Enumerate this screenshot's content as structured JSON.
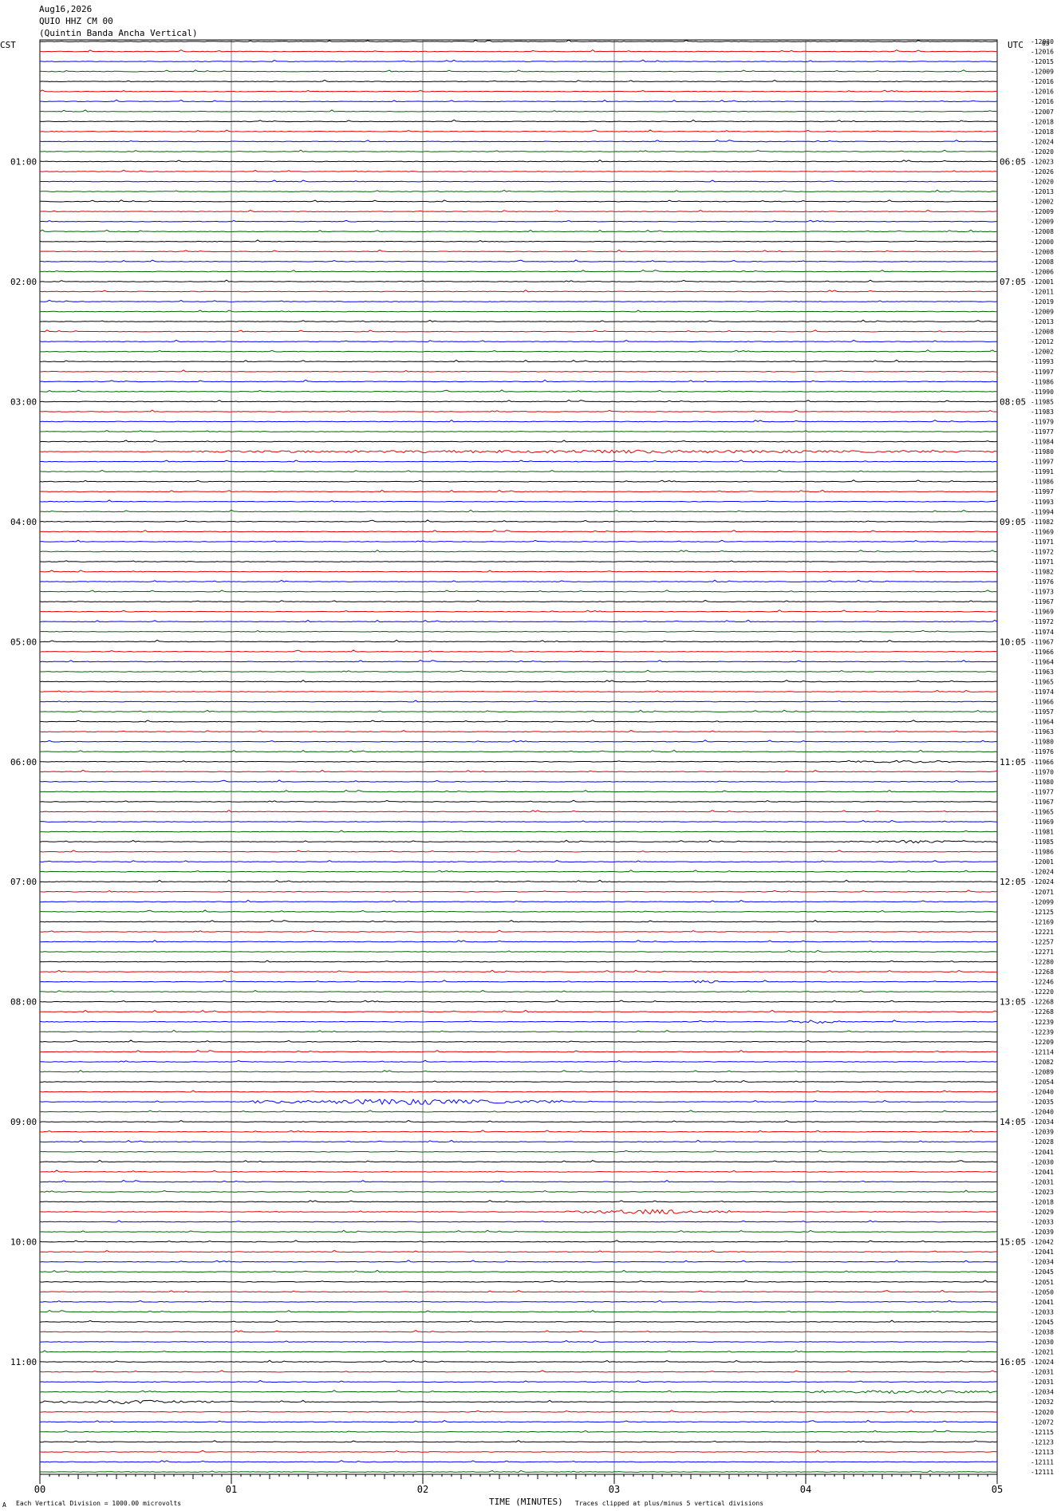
{
  "header": {
    "date": "Aug16,2026",
    "station": "QUIO HHZ CM 00",
    "description": "(Quintin Banda Ancha Vertical)",
    "left_timezone": "CST",
    "right_timezone": "UTC",
    "corner_mark": "05"
  },
  "footer": {
    "scale_note": "Each Vertical Division = 1000.00 microvolts",
    "xlabel": "TIME (MINUTES)",
    "clip_note": "Traces clipped at plus/minus 5 vertical divisions",
    "corner_mark": "A"
  },
  "colors": {
    "trace_cycle": [
      "#000000",
      "#e00000",
      "#0000ff",
      "#006400"
    ],
    "gridline": "#808080",
    "frame": "#000000"
  },
  "chart_data": {
    "type": "line",
    "title": "",
    "xlabel": "TIME (MINUTES)",
    "ylabel": "",
    "xlim": [
      0,
      5
    ],
    "x_ticks": [
      "00",
      "01",
      "02",
      "03",
      "04",
      "05"
    ],
    "trace_count": 144,
    "minutes_per_trace": 5,
    "grid": true,
    "left_hour_labels": [
      {
        "row": 12,
        "text": "01:00"
      },
      {
        "row": 24,
        "text": "02:00"
      },
      {
        "row": 36,
        "text": "03:00"
      },
      {
        "row": 48,
        "text": "04:00"
      },
      {
        "row": 60,
        "text": "05:00"
      },
      {
        "row": 72,
        "text": "06:00"
      },
      {
        "row": 84,
        "text": "07:00"
      },
      {
        "row": 96,
        "text": "08:00"
      },
      {
        "row": 108,
        "text": "09:00"
      },
      {
        "row": 120,
        "text": "10:00"
      },
      {
        "row": 132,
        "text": "11:00"
      }
    ],
    "right_hour_labels": [
      {
        "row": 12,
        "text": "06:05"
      },
      {
        "row": 24,
        "text": "07:05"
      },
      {
        "row": 36,
        "text": "08:05"
      },
      {
        "row": 48,
        "text": "09:05"
      },
      {
        "row": 60,
        "text": "10:05"
      },
      {
        "row": 72,
        "text": "11:05"
      },
      {
        "row": 84,
        "text": "12:05"
      },
      {
        "row": 96,
        "text": "13:05"
      },
      {
        "row": 108,
        "text": "14:05"
      },
      {
        "row": 120,
        "text": "15:05"
      },
      {
        "row": 132,
        "text": "16:05"
      }
    ],
    "trace_offsets": [
      "-12030",
      "-12016",
      "-12015",
      "-12009",
      "-12016",
      "-12016",
      "-12016",
      "-12007",
      "-12018",
      "-12018",
      "-12024",
      "-12020",
      "-12023",
      "-12026",
      "-12020",
      "-12013",
      "-12002",
      "-12009",
      "-12009",
      "-12008",
      "-12000",
      "-12008",
      "-12008",
      "-12006",
      "-12001",
      "-12011",
      "-12019",
      "-12009",
      "-12013",
      "-12008",
      "-12012",
      "-12002",
      "-11993",
      "-11997",
      "-11986",
      "-11990",
      "-11985",
      "-11983",
      "-11979",
      "-11977",
      "-11984",
      "-11980",
      "-11997",
      "-11991",
      "-11986",
      "-11997",
      "-11993",
      "-11994",
      "-11982",
      "-11969",
      "-11971",
      "-11972",
      "-11971",
      "-11982",
      "-11976",
      "-11973",
      "-11967",
      "-11969",
      "-11972",
      "-11974",
      "-11967",
      "-11966",
      "-11964",
      "-11963",
      "-11965",
      "-11974",
      "-11966",
      "-11957",
      "-11964",
      "-11963",
      "-11980",
      "-11976",
      "-11966",
      "-11970",
      "-11980",
      "-11977",
      "-11967",
      "-11965",
      "-11969",
      "-11981",
      "-11985",
      "-11986",
      "-12001",
      "-12024",
      "-12024",
      "-12071",
      "-12099",
      "-12125",
      "-12169",
      "-12221",
      "-12257",
      "-12271",
      "-12280",
      "-12268",
      "-12246",
      "-12220",
      "-12268",
      "-12268",
      "-12239",
      "-12239",
      "-12209",
      "-12114",
      "-12082",
      "-12089",
      "-12054",
      "-12040",
      "-12035",
      "-12040",
      "-12034",
      "-12039",
      "-12028",
      "-12041",
      "-12030",
      "-12041",
      "-12031",
      "-12023",
      "-12018",
      "-12029",
      "-12033",
      "-12039",
      "-12042",
      "-12041",
      "-12034",
      "-12045",
      "-12051",
      "-12050",
      "-12041",
      "-12033",
      "-12045",
      "-12038",
      "-12030",
      "-12021",
      "-12024",
      "-12031",
      "-12031",
      "-12034",
      "-12032",
      "-12020",
      "-12072",
      "-12115",
      "-12123",
      "-12113",
      "-12111",
      "-12111"
    ],
    "events": [
      {
        "row": 41,
        "start_min": 0.8,
        "end_min": 5.0,
        "peak": 1.0
      },
      {
        "row": 106,
        "start_min": 1.1,
        "end_min": 2.7,
        "peak": 2.0
      },
      {
        "row": 117,
        "start_min": 2.75,
        "end_min": 3.6,
        "peak": 1.6
      },
      {
        "row": 98,
        "start_min": 3.9,
        "end_min": 4.2,
        "peak": 1.0
      },
      {
        "row": 94,
        "start_min": 3.4,
        "end_min": 3.55,
        "peak": 1.2
      },
      {
        "row": 136,
        "start_min": 0.0,
        "end_min": 0.9,
        "peak": 1.2
      },
      {
        "row": 135,
        "start_min": 4.0,
        "end_min": 5.0,
        "peak": 1.0
      },
      {
        "row": 80,
        "start_min": 4.2,
        "end_min": 5.0,
        "peak": 0.7
      },
      {
        "row": 72,
        "start_min": 4.25,
        "end_min": 4.75,
        "peak": 0.7
      }
    ]
  }
}
